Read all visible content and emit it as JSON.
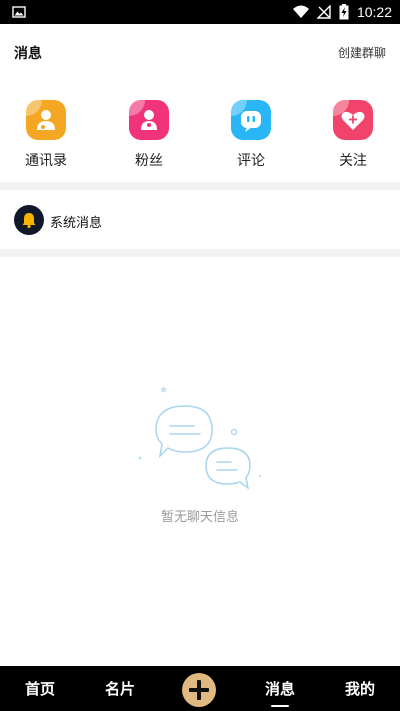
{
  "status_bar": {
    "time": "10:22",
    "left_icon": "image-icon",
    "right_icons": [
      "wifi-icon",
      "signal-icon",
      "battery-charging-icon"
    ]
  },
  "header": {
    "title": "消息",
    "action_label": "创建群聊"
  },
  "quick_actions": [
    {
      "label": "通讯录",
      "icon": "contacts-icon",
      "color": "#f5a623"
    },
    {
      "label": "粉丝",
      "icon": "fans-icon",
      "color": "#f0337a"
    },
    {
      "label": "评论",
      "icon": "comment-icon",
      "color": "#29b6f6"
    },
    {
      "label": "关注",
      "icon": "heart-plus-icon",
      "color": "#f2446b"
    }
  ],
  "system_message": {
    "label": "系统消息",
    "icon": "bell-icon"
  },
  "empty_state": {
    "text": "暂无聊天信息",
    "icon": "chat-bubbles-icon"
  },
  "tab_bar": {
    "tabs": [
      {
        "label": "首页"
      },
      {
        "label": "名片"
      },
      {
        "label": "消息",
        "active": true
      },
      {
        "label": "我的"
      }
    ],
    "plus_icon": "plus-icon",
    "accent": "#e0b981"
  }
}
